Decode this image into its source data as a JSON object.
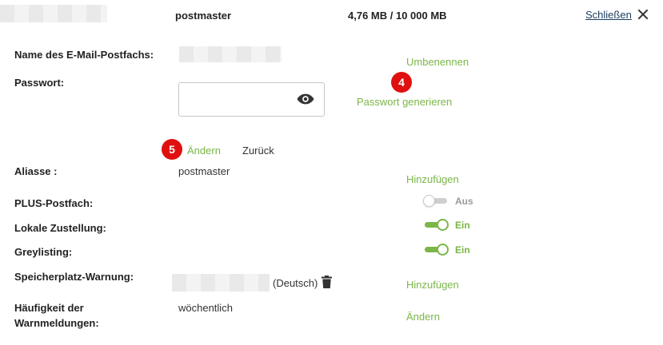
{
  "header": {
    "mailbox_name": "postmaster",
    "usage": "4,76 MB / 10 000 MB",
    "close_label": "Schließen"
  },
  "fields": {
    "mailbox_name_label": "Name des E-Mail-Postfachs:",
    "rename_link": "Umbenennen",
    "password_label": "Passwort:",
    "password_value": "",
    "generate_password_link": "Passwort generieren",
    "change_button": "Ändern",
    "back_button": "Zurück",
    "aliases_label": "Aliasse :",
    "alias_value": "postmaster",
    "add_alias_link": "Hinzufügen",
    "plus_label": "PLUS-Postfach:",
    "plus_state": "Aus",
    "local_delivery_label": "Lokale Zustellung:",
    "local_delivery_state": "Ein",
    "greylisting_label": "Greylisting:",
    "greylisting_state": "Ein",
    "storage_warning_label": "Speicherplatz-Warnung:",
    "storage_warning_lang": "(Deutsch)",
    "add_warning_link": "Hinzufügen",
    "warning_freq_label_line1": "Häufigkeit der",
    "warning_freq_label_line2": "Warnmeldungen:",
    "warning_freq_value": "wöchentlich",
    "change_freq_link": "Ändern"
  },
  "annotations": {
    "badge_4": "4",
    "badge_5": "5"
  },
  "icons": {
    "show_password": "eye-icon",
    "close": "close-icon",
    "delete": "trash-icon"
  },
  "colors": {
    "accent_green": "#7ab648",
    "badge_red": "#e01010",
    "link_blue": "#1a3b5d"
  }
}
